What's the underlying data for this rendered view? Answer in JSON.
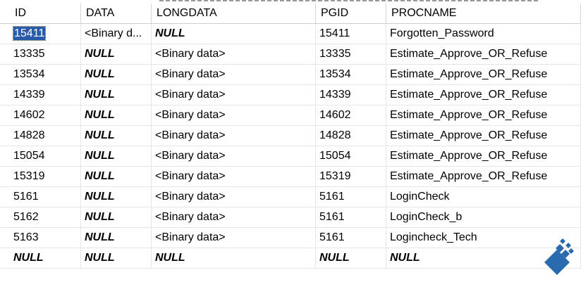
{
  "columns": [
    {
      "label": "ID"
    },
    {
      "label": "DATA"
    },
    {
      "label": "LONGDATA"
    },
    {
      "label": "PGID"
    },
    {
      "label": "PROCNAME"
    }
  ],
  "rows": [
    {
      "id": "15411",
      "data": "<Binary d...",
      "longdata": "NULL",
      "pgid": "15411",
      "procname": "Forgotten_Password"
    },
    {
      "id": "13335",
      "data": "NULL",
      "longdata": "<Binary data>",
      "pgid": "13335",
      "procname": "Estimate_Approve_OR_Refuse"
    },
    {
      "id": "13534",
      "data": "NULL",
      "longdata": "<Binary data>",
      "pgid": "13534",
      "procname": "Estimate_Approve_OR_Refuse"
    },
    {
      "id": "14339",
      "data": "NULL",
      "longdata": "<Binary data>",
      "pgid": "14339",
      "procname": "Estimate_Approve_OR_Refuse"
    },
    {
      "id": "14602",
      "data": "NULL",
      "longdata": "<Binary data>",
      "pgid": "14602",
      "procname": "Estimate_Approve_OR_Refuse"
    },
    {
      "id": "14828",
      "data": "NULL",
      "longdata": "<Binary data>",
      "pgid": "14828",
      "procname": "Estimate_Approve_OR_Refuse"
    },
    {
      "id": "15054",
      "data": "NULL",
      "longdata": "<Binary data>",
      "pgid": "15054",
      "procname": "Estimate_Approve_OR_Refuse"
    },
    {
      "id": "15319",
      "data": "NULL",
      "longdata": "<Binary data>",
      "pgid": "15319",
      "procname": "Estimate_Approve_OR_Refuse"
    },
    {
      "id": "5161",
      "data": "NULL",
      "longdata": "<Binary data>",
      "pgid": "5161",
      "procname": "LoginCheck"
    },
    {
      "id": "5162",
      "data": "NULL",
      "longdata": "<Binary data>",
      "pgid": "5161",
      "procname": "LoginCheck_b"
    },
    {
      "id": "5163",
      "data": "NULL",
      "longdata": "<Binary data>",
      "pgid": "5161",
      "procname": "Logincheck_Tech"
    },
    {
      "id": "NULL",
      "data": "NULL",
      "longdata": "NULL",
      "pgid": "NULL",
      "procname": "NULL"
    }
  ],
  "selected_cell": {
    "row": 0,
    "column": "id"
  },
  "colors": {
    "selection": "#2a5ba8",
    "logo": "#2a6bb0",
    "grid_line": "#e6e6e6"
  },
  "icons": {
    "watermark": "diamond-logo-icon"
  }
}
